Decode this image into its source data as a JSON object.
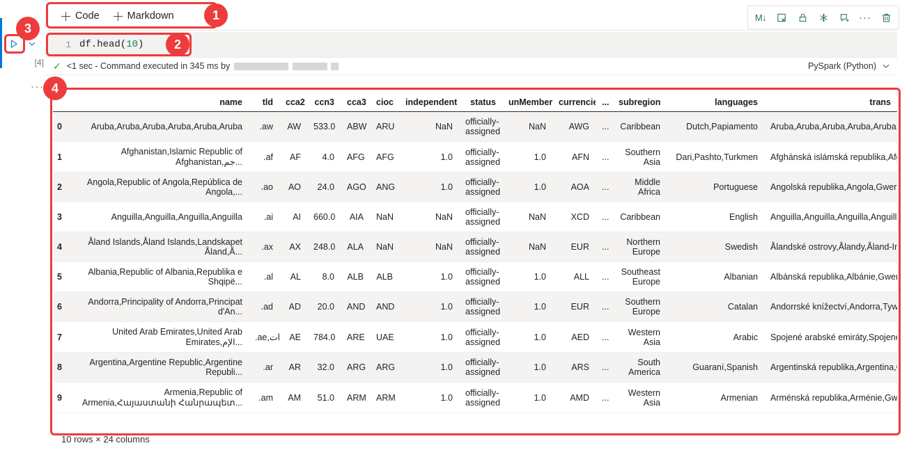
{
  "toolbar": {
    "code_label": "Code",
    "markdown_label": "Markdown",
    "plus_icon": "plus-icon"
  },
  "icon_strip": {
    "markdown_toggle": "M↓",
    "clear_output": "clear-output-icon",
    "lock": "lock-icon",
    "freeze": "freeze-icon",
    "comment": "add-comment-icon",
    "more": "···",
    "delete": "delete-icon"
  },
  "gutter": {
    "run_icon": "run-cell-icon",
    "chevron_icon": "chevron-down-icon",
    "exec_count": "[4]",
    "output_more": "···"
  },
  "editor": {
    "line_number": "1",
    "code_prefix": "df.head(",
    "code_number": "10",
    "code_suffix": ")"
  },
  "status": {
    "check": "✓",
    "text": "<1 sec - Command executed in 345 ms by",
    "kernel": "PySpark (Python)",
    "kernel_chevron": "chevron-down-icon"
  },
  "shape_note": "10 rows × 24 columns",
  "table": {
    "columns": [
      "",
      "name",
      "tld",
      "cca2",
      "ccn3",
      "cca3",
      "cioc",
      "independent",
      "status",
      "unMember",
      "currencies",
      "...",
      "subregion",
      "languages",
      "trans"
    ],
    "rows": [
      {
        "idx": "0",
        "name": "Aruba,Aruba,Aruba,Aruba,Aruba,Aruba",
        "tld": ".aw",
        "cca2": "AW",
        "ccn3": "533.0",
        "cca3": "ABW",
        "cioc": "ARU",
        "independent": "NaN",
        "status": "officially-assigned",
        "unMember": "NaN",
        "currencies": "AWG",
        "ellipsis": "...",
        "subregion": "Caribbean",
        "languages": "Dutch,Papiamento",
        "translations": "Aruba,Aruba,Aruba,Aruba,Aruba,Aruba,Aruba,Aruba"
      },
      {
        "idx": "1",
        "name": "Afghanistan,Islamic Republic of Afghanistan,جم...",
        "tld": ".af",
        "cca2": "AF",
        "ccn3": "4.0",
        "cca3": "AFG",
        "cioc": "AFG",
        "independent": "1.0",
        "status": "officially-assigned",
        "unMember": "1.0",
        "currencies": "AFN",
        "ellipsis": "...",
        "subregion": "Southern Asia",
        "languages": "Dari,Pashto,Turkmen",
        "translations": "Afghánská islámská republika,Afghánistán,"
      },
      {
        "idx": "2",
        "name": "Angola,Republic of Angola,República de Angola,...",
        "tld": ".ao",
        "cca2": "AO",
        "ccn3": "24.0",
        "cca3": "AGO",
        "cioc": "ANG",
        "independent": "1.0",
        "status": "officially-assigned",
        "unMember": "1.0",
        "currencies": "AOA",
        "ellipsis": "...",
        "subregion": "Middle Africa",
        "languages": "Portuguese",
        "translations": "Angolská republika,Angola,Gweriniaeth Ang"
      },
      {
        "idx": "3",
        "name": "Anguilla,Anguilla,Anguilla,Anguilla",
        "tld": ".ai",
        "cca2": "AI",
        "ccn3": "660.0",
        "cca3": "AIA",
        "cioc": "NaN",
        "independent": "NaN",
        "status": "officially-assigned",
        "unMember": "NaN",
        "currencies": "XCD",
        "ellipsis": "...",
        "subregion": "Caribbean",
        "languages": "English",
        "translations": "Anguilla,Anguilla,Anguilla,Anguilla,Ang"
      },
      {
        "idx": "4",
        "name": "Åland Islands,Åland Islands,Landskapet Åland,Å...",
        "tld": ".ax",
        "cca2": "AX",
        "ccn3": "248.0",
        "cca3": "ALA",
        "cioc": "NaN",
        "independent": "NaN",
        "status": "officially-assigned",
        "unMember": "NaN",
        "currencies": "EUR",
        "ellipsis": "...",
        "subregion": "Northern Europe",
        "languages": "Swedish",
        "translations": "Ålandské ostrovy,Ålandy,Åland-Inseln,Ålan"
      },
      {
        "idx": "5",
        "name": "Albania,Republic of Albania,Republika e Shqipë...",
        "tld": ".al",
        "cca2": "AL",
        "ccn3": "8.0",
        "cca3": "ALB",
        "cioc": "ALB",
        "independent": "1.0",
        "status": "officially-assigned",
        "unMember": "1.0",
        "currencies": "ALL",
        "ellipsis": "...",
        "subregion": "Southeast Europe",
        "languages": "Albanian",
        "translations": "Albánská republika,Albánie,Gweriniaeth A"
      },
      {
        "idx": "6",
        "name": "Andorra,Principality of Andorra,Principat d'An...",
        "tld": ".ad",
        "cca2": "AD",
        "ccn3": "20.0",
        "cca3": "AND",
        "cioc": "AND",
        "independent": "1.0",
        "status": "officially-assigned",
        "unMember": "1.0",
        "currencies": "EUR",
        "ellipsis": "...",
        "subregion": "Southern Europe",
        "languages": "Catalan",
        "translations": "Andorrské knížectví,Andorra,Tywysogaeth A"
      },
      {
        "idx": "7",
        "name": "United Arab Emirates,United Arab Emirates,الإم...",
        "tld": ".ae,امارات.",
        "cca2": "AE",
        "ccn3": "784.0",
        "cca3": "ARE",
        "cioc": "UAE",
        "independent": "1.0",
        "status": "officially-assigned",
        "unMember": "1.0",
        "currencies": "AED",
        "ellipsis": "...",
        "subregion": "Western Asia",
        "languages": "Arabic",
        "translations": "Spojené arabské emiráty,Spojené arabské "
      },
      {
        "idx": "8",
        "name": "Argentina,Argentine Republic,Argentine Republi...",
        "tld": ".ar",
        "cca2": "AR",
        "ccn3": "32.0",
        "cca3": "ARG",
        "cioc": "ARG",
        "independent": "1.0",
        "status": "officially-assigned",
        "unMember": "1.0",
        "currencies": "ARS",
        "ellipsis": "...",
        "subregion": "South America",
        "languages": "Guaraní,Spanish",
        "translations": "Argentinská republika,Argentina,Gwerinia"
      },
      {
        "idx": "9",
        "name": "Armenia,Republic of Armenia,Հայաստանի Հանրապետ...",
        "tld": ".am",
        "cca2": "AM",
        "ccn3": "51.0",
        "cca3": "ARM",
        "cioc": "ARM",
        "independent": "1.0",
        "status": "officially-assigned",
        "unMember": "1.0",
        "currencies": "AMD",
        "ellipsis": "...",
        "subregion": "Western Asia",
        "languages": "Armenian",
        "translations": "Arménská republika,Arménie,Gweriniaeth Ar"
      }
    ]
  },
  "annotations": [
    {
      "label": "1"
    },
    {
      "label": "2"
    },
    {
      "label": "3"
    },
    {
      "label": "4"
    }
  ],
  "colors": {
    "accent_red": "#ee3b3b",
    "selection_blue": "#0078d4",
    "icon_teal": "#2b6b6b",
    "success_green": "#3a9b35",
    "code_bg": "#f3f2f1",
    "row_alt": "#f4f3f2"
  }
}
